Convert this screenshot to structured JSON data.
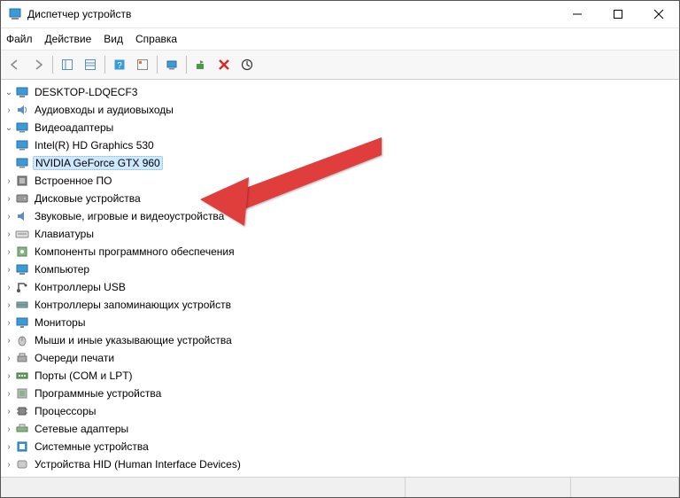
{
  "window": {
    "title": "Диспетчер устройств"
  },
  "menu": {
    "file": "Файл",
    "action": "Действие",
    "view": "Вид",
    "help": "Справка"
  },
  "root": {
    "name": "DESKTOP-LDQECF3",
    "expanded": true,
    "categories": [
      {
        "icon": "audio",
        "label": "Аудиовходы и аудиовыходы",
        "expanded": false
      },
      {
        "icon": "display",
        "label": "Видеоадаптеры",
        "expanded": true,
        "children": [
          {
            "icon": "display",
            "label": "Intel(R) HD Graphics 530",
            "selected": false
          },
          {
            "icon": "display",
            "label": "NVIDIA GeForce GTX 960",
            "selected": true
          }
        ]
      },
      {
        "icon": "firmware",
        "label": "Встроенное ПО",
        "expanded": false
      },
      {
        "icon": "disk",
        "label": "Дисковые устройства",
        "expanded": false
      },
      {
        "icon": "sound",
        "label": "Звуковые, игровые и видеоустройства",
        "expanded": false
      },
      {
        "icon": "keyboard",
        "label": "Клавиатуры",
        "expanded": false
      },
      {
        "icon": "software",
        "label": "Компоненты программного обеспечения",
        "expanded": false
      },
      {
        "icon": "computer",
        "label": "Компьютер",
        "expanded": false
      },
      {
        "icon": "usb",
        "label": "Контроллеры USB",
        "expanded": false
      },
      {
        "icon": "storage",
        "label": "Контроллеры запоминающих устройств",
        "expanded": false
      },
      {
        "icon": "monitor",
        "label": "Мониторы",
        "expanded": false
      },
      {
        "icon": "mouse",
        "label": "Мыши и иные указывающие устройства",
        "expanded": false
      },
      {
        "icon": "printer",
        "label": "Очереди печати",
        "expanded": false
      },
      {
        "icon": "port",
        "label": "Порты (COM и LPT)",
        "expanded": false
      },
      {
        "icon": "softdev",
        "label": "Программные устройства",
        "expanded": false
      },
      {
        "icon": "cpu",
        "label": "Процессоры",
        "expanded": false
      },
      {
        "icon": "network",
        "label": "Сетевые адаптеры",
        "expanded": false
      },
      {
        "icon": "system",
        "label": "Системные устройства",
        "expanded": false
      },
      {
        "icon": "hid",
        "label": "Устройства HID (Human Interface Devices)",
        "expanded": false
      }
    ]
  },
  "arrows": {
    "expanded": "⌄",
    "collapsed": "›"
  }
}
